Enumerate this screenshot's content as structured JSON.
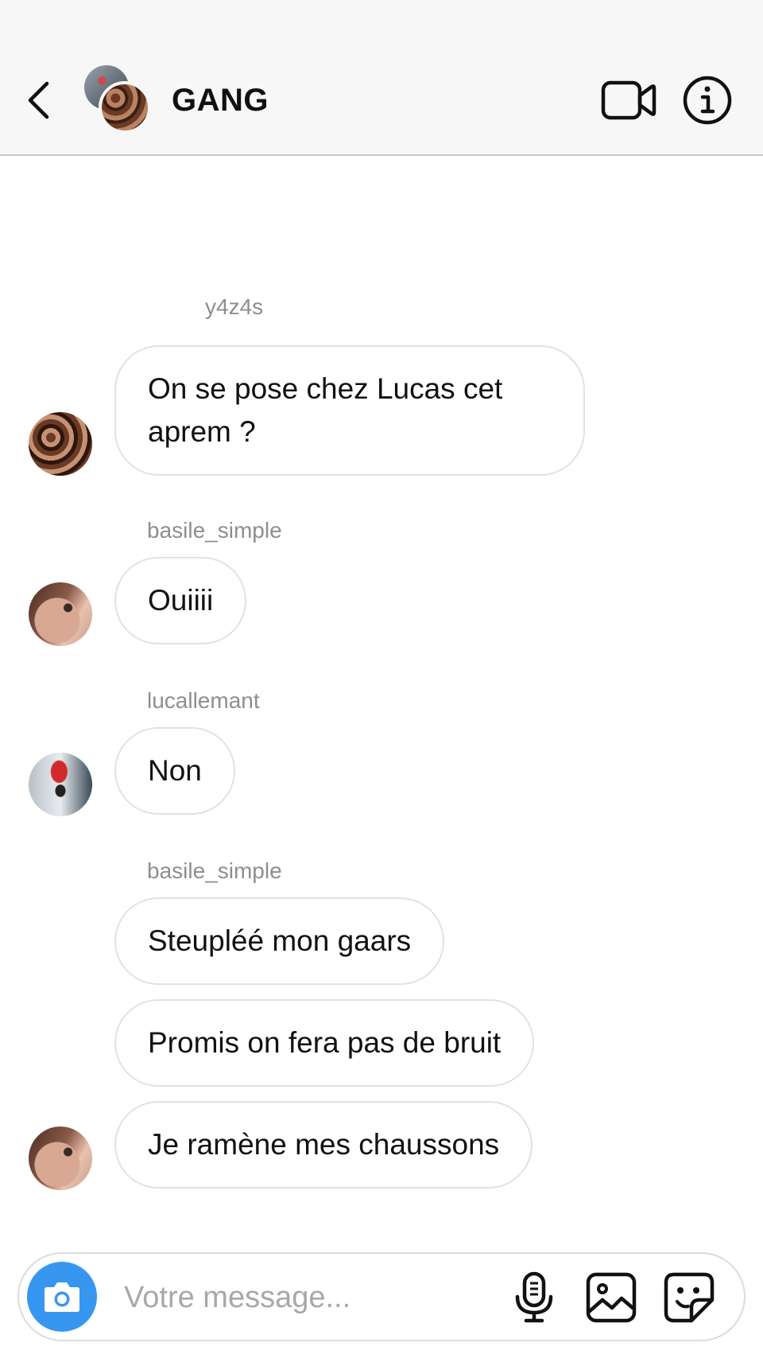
{
  "header": {
    "title": "GANG",
    "back_icon": "chevron-left-icon",
    "video_icon": "video-camera-icon",
    "info_icon": "info-icon"
  },
  "messages": [
    {
      "sender": "y4z4s",
      "text": "On se pose chez Lucas cet aprem ?"
    },
    {
      "sender": "basile_simple",
      "text": "Ouiiii"
    },
    {
      "sender": "lucallemant",
      "text": "Non"
    },
    {
      "sender": "basile_simple",
      "text": "Steupléé mon gaars"
    },
    {
      "sender": "basile_simple",
      "text": "Promis on fera pas de bruit"
    },
    {
      "sender": "basile_simple",
      "text": "Je ramène mes chaussons"
    }
  ],
  "composer": {
    "placeholder": "Votre message...",
    "camera_icon": "camera-icon",
    "mic_icon": "microphone-icon",
    "gallery_icon": "image-gallery-icon",
    "sticker_icon": "sticker-icon"
  },
  "colors": {
    "accent": "#3797f0",
    "header_bg": "#f7f7f7",
    "bubble_border": "#e2e2e2",
    "sender_text": "#8e8e8e"
  }
}
